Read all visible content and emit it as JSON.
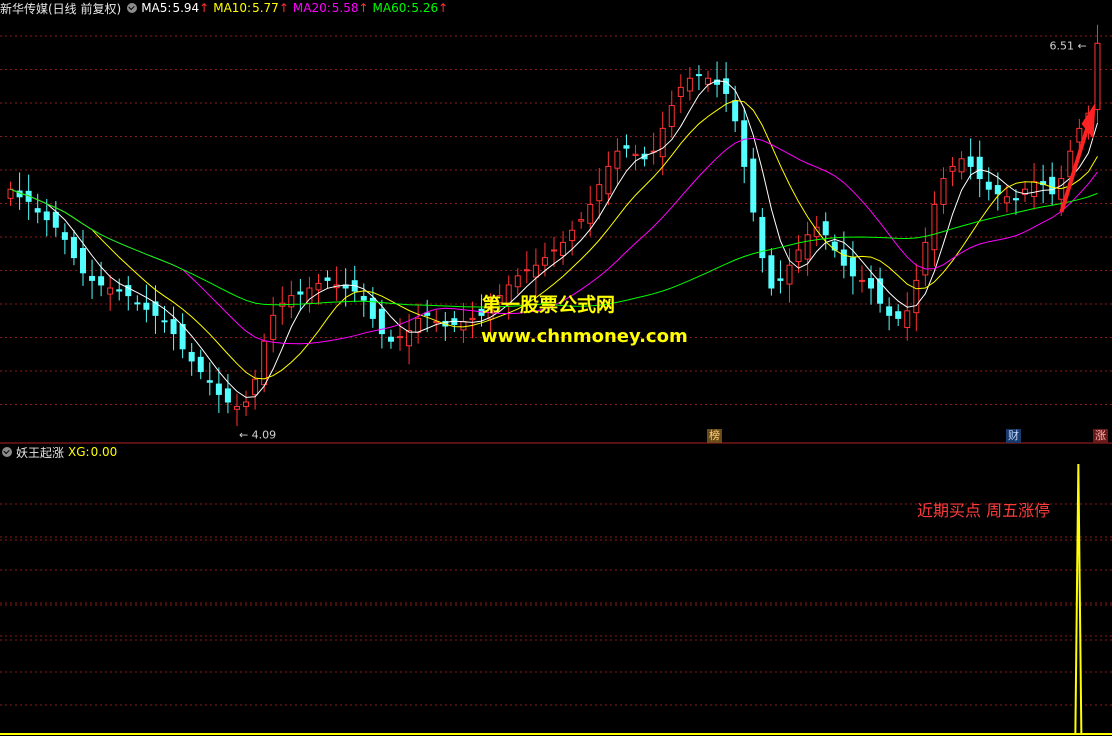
{
  "header": {
    "title": "新华传媒(日线 前复权)",
    "ma5_label": "MA5:",
    "ma5_value": "5.94",
    "ma10_label": "MA10:",
    "ma10_value": "5.77",
    "ma20_label": "MA20:",
    "ma20_value": "5.58",
    "ma60_label": "MA60:",
    "ma60_value": "5.26",
    "arrow": "↑"
  },
  "indicator": {
    "name": "妖王起涨",
    "xg_label": "XG:",
    "xg_value": "0.00"
  },
  "watermark": {
    "line1": "第一股票公式网",
    "line2": "www.chnmoney.com"
  },
  "annotation": "近期买点 周五涨停",
  "tags": {
    "bang": "榜",
    "cai": "财",
    "zhang": "涨"
  },
  "colors": {
    "up": "#ff3232",
    "down": "#54ffff",
    "ma5": "#ffffff",
    "ma10": "#ffff00",
    "ma20": "#ff00ff",
    "ma60": "#00ff00",
    "grid": "#8b1a1a",
    "xg": "#ffff00"
  },
  "chart_data": [
    {
      "type": "candlestick",
      "title": "新华传媒(日线 前复权)",
      "max_label": "6.51",
      "min_label": "4.09",
      "ylim": [
        3.9,
        6.65
      ],
      "series": [
        {
          "name": "MA5",
          "last": 5.94
        },
        {
          "name": "MA10",
          "last": 5.77
        },
        {
          "name": "MA20",
          "last": 5.58
        },
        {
          "name": "MA60",
          "last": 5.26
        }
      ],
      "close": [
        5.55,
        5.5,
        5.47,
        5.4,
        5.35,
        5.3,
        5.22,
        5.1,
        5.0,
        4.95,
        4.92,
        4.9,
        4.88,
        4.85,
        4.8,
        4.76,
        4.72,
        4.68,
        4.6,
        4.5,
        4.42,
        4.35,
        4.28,
        4.2,
        4.15,
        4.12,
        4.15,
        4.3,
        4.55,
        4.72,
        4.8,
        4.85,
        4.86,
        4.9,
        4.93,
        4.95,
        4.92,
        4.9,
        4.88,
        4.82,
        4.7,
        4.6,
        4.55,
        4.58,
        4.62,
        4.7,
        4.72,
        4.68,
        4.65,
        4.66,
        4.68,
        4.7,
        4.72,
        4.78,
        4.85,
        4.92,
        4.98,
        5.02,
        5.05,
        5.1,
        5.15,
        5.2,
        5.28,
        5.35,
        5.45,
        5.58,
        5.7,
        5.8,
        5.82,
        5.78,
        5.75,
        5.8,
        5.95,
        6.1,
        6.22,
        6.28,
        6.3,
        6.28,
        6.24,
        6.18,
        6.0,
        5.7,
        5.4,
        5.1,
        4.9,
        4.95,
        5.05,
        5.15,
        5.25,
        5.3,
        5.25,
        5.15,
        5.05,
        4.98,
        4.95,
        4.9,
        4.8,
        4.72,
        4.7,
        4.75,
        4.95,
        5.2,
        5.45,
        5.62,
        5.7,
        5.75,
        5.7,
        5.62,
        5.55,
        5.52,
        5.5,
        5.48,
        5.55,
        5.6,
        5.58,
        5.52,
        5.62,
        5.8,
        5.95,
        6.05,
        6.51
      ],
      "xg_signal_index": 118,
      "xg_signal_value": 1
    }
  ]
}
